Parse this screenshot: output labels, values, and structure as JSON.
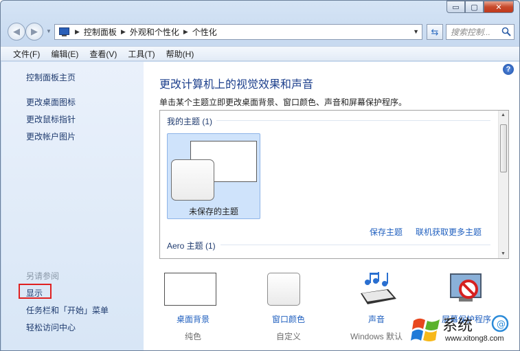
{
  "window": {
    "caption_buttons": {
      "minimize": "▭",
      "maximize": "▢",
      "close": "✕"
    }
  },
  "navigation": {
    "back_icon": "back-arrow-icon",
    "forward_icon": "forward-arrow-icon",
    "breadcrumbs": [
      "控制面板",
      "外观和个性化",
      "个性化"
    ],
    "search_placeholder": "搜索控制...",
    "refresh_icon": "refresh-icon"
  },
  "menubar": {
    "items": [
      "文件(F)",
      "编辑(E)",
      "查看(V)",
      "工具(T)",
      "帮助(H)"
    ]
  },
  "sidebar": {
    "links": [
      "控制面板主页",
      "更改桌面图标",
      "更改鼠标指针",
      "更改帐户图片"
    ],
    "see_also_heading": "另请参阅",
    "see_also_links": [
      "显示",
      "任务栏和「开始」菜单",
      "轻松访问中心"
    ]
  },
  "main": {
    "title": "更改计算机上的视觉效果和声音",
    "description": "单击某个主题立即更改桌面背景、窗口颜色、声音和屏幕保护程序。",
    "themes": {
      "my_themes_label": "我的主题 (1)",
      "unsaved_theme_label": "未保存的主题",
      "save_theme_link": "保存主题",
      "get_more_link": "联机获取更多主题",
      "aero_label": "Aero 主题 (1)"
    },
    "settings": [
      {
        "label": "桌面背景",
        "value": "纯色",
        "icon": "desktop-background-icon"
      },
      {
        "label": "窗口颜色",
        "value": "自定义",
        "icon": "window-color-icon"
      },
      {
        "label": "声音",
        "value": "Windows 默认",
        "icon": "sound-icon"
      },
      {
        "label": "屏幕保护程序",
        "value": "",
        "icon": "screensaver-icon"
      }
    ]
  },
  "watermark": {
    "text": "系统",
    "url": "www.xitong8.com"
  },
  "colors": {
    "link": "#1f5fbf",
    "title": "#1c3f8c",
    "highlight_box": "#e02020",
    "selected_tile": "#cfe3fb"
  }
}
